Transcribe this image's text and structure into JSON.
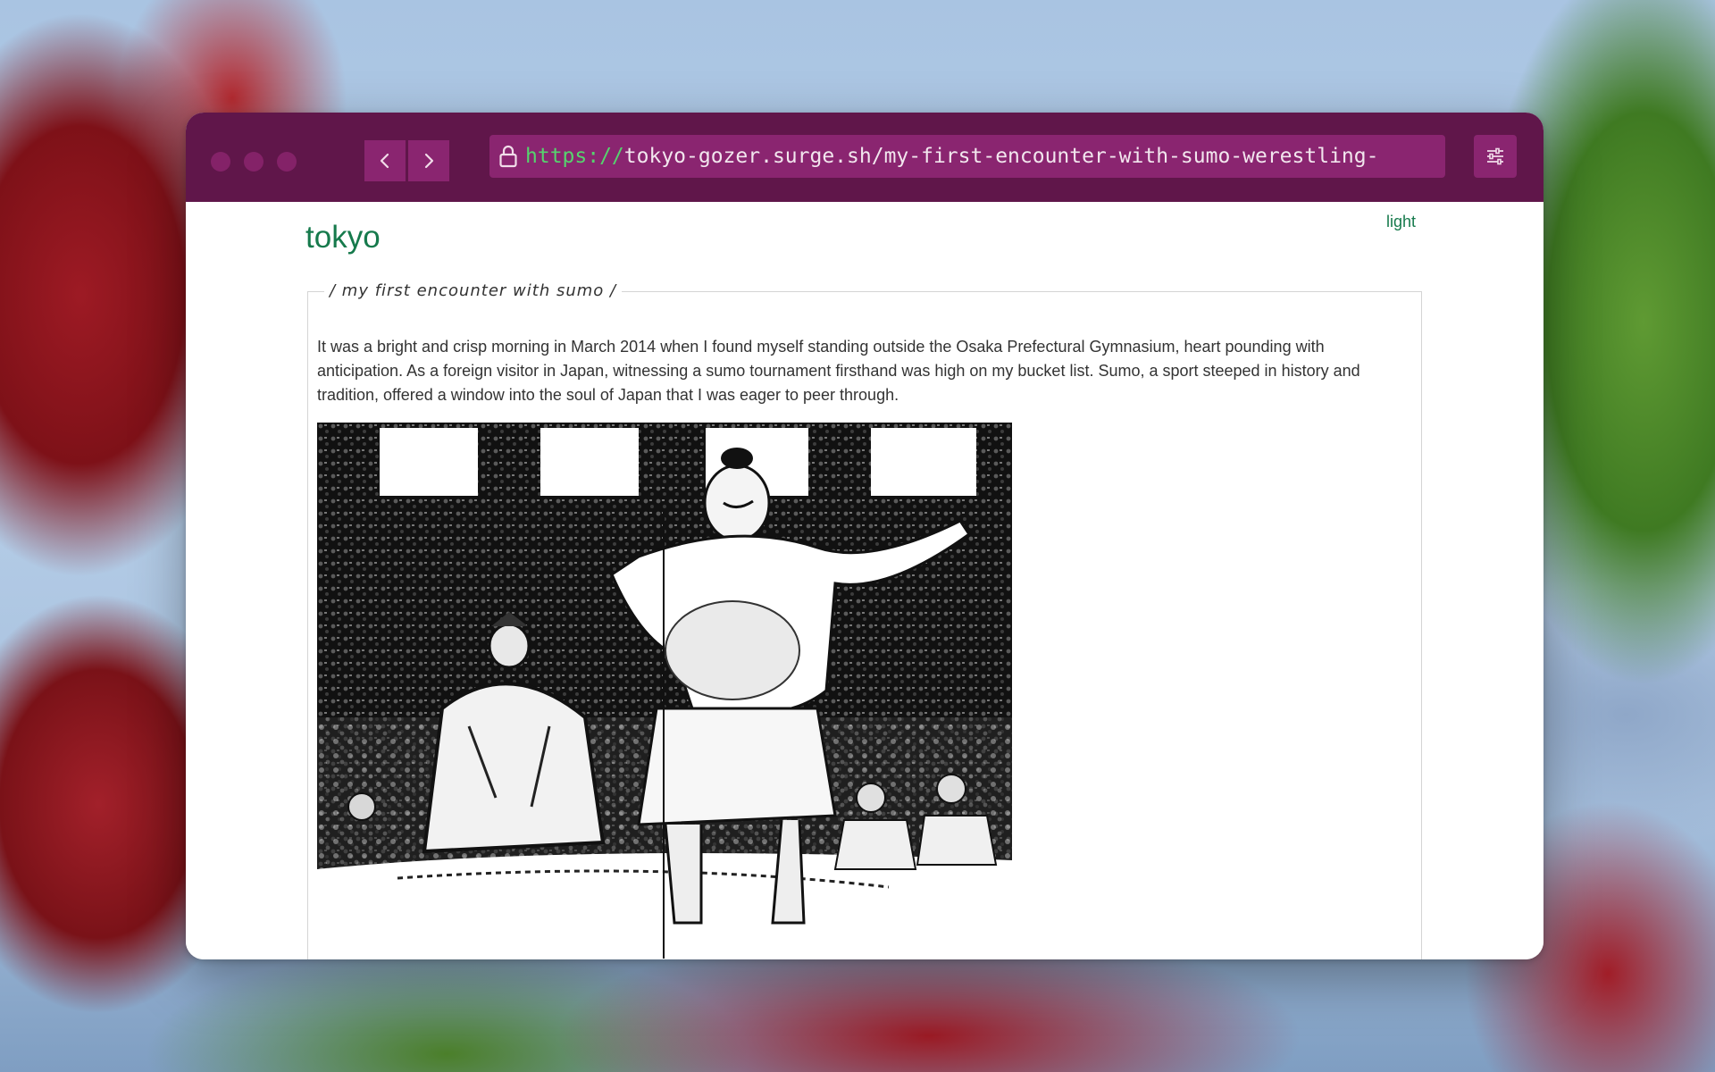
{
  "browser": {
    "url_scheme": "https://",
    "url_rest": "tokyo-gozer.surge.sh/my-first-encounter-with-sumo-werestling-",
    "back_icon": "chevron-left-icon",
    "forward_icon": "chevron-right-icon",
    "lock_icon": "lock-icon",
    "settings_icon": "sliders-icon"
  },
  "site": {
    "title": "tokyo",
    "theme_toggle": "light",
    "accent_color": "#167a4c",
    "titlebar_color": "#60164a"
  },
  "article": {
    "heading": "/ my first encounter with sumo /",
    "body": "It was a bright and crisp morning in March 2014 when I found myself standing outside the Osaka Prefectural Gymnasium, heart pounding with anticipation. As a foreign visitor in Japan, witnessing a sumo tournament firsthand was high on my bucket list. Sumo, a sport steeped in history and tradition, offered a window into the soul of Japan that I was eager to peer through."
  }
}
